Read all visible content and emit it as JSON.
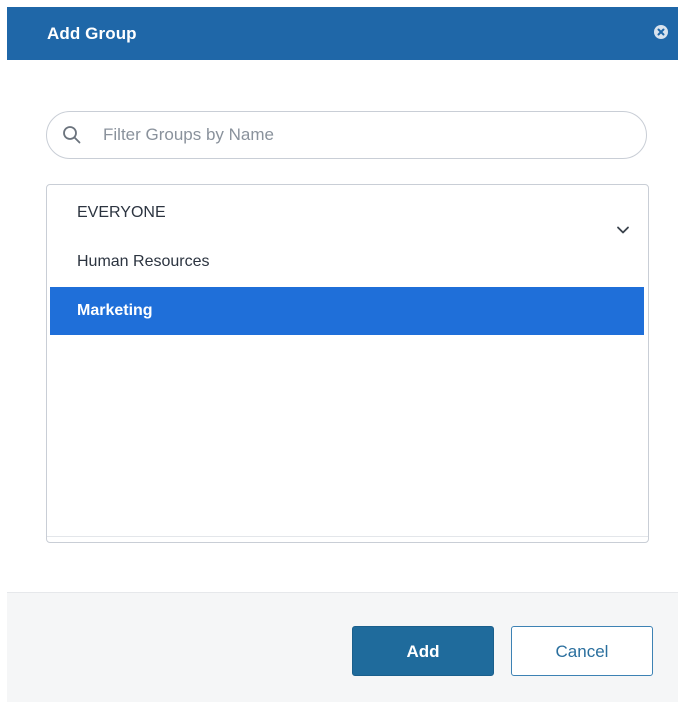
{
  "dialog": {
    "title": "Add Group",
    "close_icon": "close-circle-icon"
  },
  "search": {
    "placeholder": "Filter Groups by Name",
    "value": "",
    "icon": "search-icon"
  },
  "groups": {
    "items": [
      {
        "label": "EVERYONE",
        "selected": false,
        "has_chevron": true
      },
      {
        "label": "Human Resources",
        "selected": false,
        "has_chevron": false
      },
      {
        "label": "Marketing",
        "selected": true,
        "has_chevron": false
      }
    ],
    "chevron_icon": "chevron-down-icon"
  },
  "footer": {
    "add_label": "Add",
    "cancel_label": "Cancel"
  },
  "colors": {
    "header_bg": "#1f67a8",
    "selected_row_bg": "#1f6fd9",
    "add_button_bg": "#1f6b9c",
    "cancel_border": "#3d82b4"
  }
}
